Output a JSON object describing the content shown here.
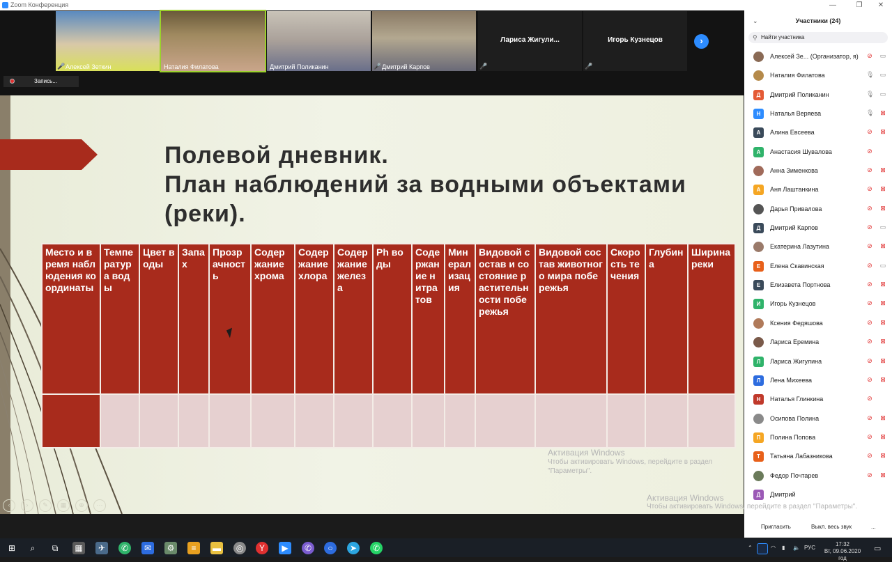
{
  "window": {
    "title": "Zoom Конференция",
    "minimize": "—",
    "restore": "❐",
    "close": "✕"
  },
  "videos": [
    {
      "name": "Алексей Зеткин",
      "muted": true
    },
    {
      "name": "Наталия Филатова",
      "muted": false,
      "active": true
    },
    {
      "name": "Дмитрий Поликанин",
      "muted": false
    },
    {
      "name": "Дмитрий Карпов",
      "muted": true
    },
    {
      "name": "Лариса  Жигули...",
      "muted": true,
      "video": false
    },
    {
      "name": "Игорь Кузнецов",
      "muted": true,
      "video": false
    }
  ],
  "recording": {
    "label": "Запись..."
  },
  "slide": {
    "title": "Полевой дневник.\nПлан наблюдений за водными объектами\n(реки).",
    "columns": [
      "Место и время наблюдения координаты",
      "Температура воды",
      "Цвет воды",
      "Запах",
      "Прозрачность",
      "Содержание хрома",
      "Содержание хлора",
      "Содержание железа",
      "Ph воды",
      "Содержание нитратов",
      "Минерализация",
      "Видовой состав и состояние растительности побережья",
      "Видовой состав животного мира побережья",
      "Скорость течения",
      "Глубина",
      "Ширина реки"
    ]
  },
  "activation": {
    "title": "Активация Windows",
    "body": "Чтобы активировать Windows, перейдите в раздел \"Параметры\".",
    "panel_body": "Чтобы активировать Windows, перейдите в раздел \"Параметры\"."
  },
  "participants_panel": {
    "title": "Участники (24)",
    "search_placeholder": "Найти участника",
    "participants": [
      {
        "name": "Алексей Зе... (Организатор, я)",
        "avatar": "photo",
        "color": "#8a6a55",
        "mic": "muted",
        "cam": "on"
      },
      {
        "name": "Наталия Филатова",
        "avatar": "photo",
        "color": "#b58a4a",
        "mic": "on",
        "cam": "on"
      },
      {
        "name": "Дмитрий Поликанин",
        "avatar": "Д",
        "color": "#e45a35",
        "mic": "on",
        "cam": "on"
      },
      {
        "name": "Наталья Веряева",
        "avatar": "Н",
        "color": "#2d8cff",
        "mic": "on",
        "cam": "off"
      },
      {
        "name": "Алина Евсеева",
        "avatar": "А",
        "color": "#3a4a5a",
        "mic": "muted",
        "cam": "off"
      },
      {
        "name": "Анастасия Шувалова",
        "avatar": "А",
        "color": "#2fb36a",
        "mic": "muted",
        "cam": "none"
      },
      {
        "name": "Анна Зименкова",
        "avatar": "photo",
        "color": "#a06a5a",
        "mic": "muted",
        "cam": "off"
      },
      {
        "name": "Аня Лаштанкина",
        "avatar": "А",
        "color": "#f5a623",
        "mic": "muted",
        "cam": "off"
      },
      {
        "name": "Дарья Привалова",
        "avatar": "photo",
        "color": "#555555",
        "mic": "muted",
        "cam": "off"
      },
      {
        "name": "Дмитрий Карпов",
        "avatar": "Д",
        "color": "#3a4a5a",
        "mic": "muted",
        "cam": "on"
      },
      {
        "name": "Екатерина Лазутина",
        "avatar": "photo",
        "color": "#9a7a6a",
        "mic": "muted",
        "cam": "off"
      },
      {
        "name": "Елена Скавинская",
        "avatar": "Е",
        "color": "#e8601a",
        "mic": "muted",
        "cam": "on"
      },
      {
        "name": "Елизавета Портнова",
        "avatar": "Е",
        "color": "#3a4a5a",
        "mic": "muted",
        "cam": "off"
      },
      {
        "name": "Игорь Кузнецов",
        "avatar": "И",
        "color": "#2fb36a",
        "mic": "muted",
        "cam": "off"
      },
      {
        "name": "Ксения Федяшова",
        "avatar": "photo",
        "color": "#b07a5a",
        "mic": "muted",
        "cam": "off"
      },
      {
        "name": "Лариса Еремина",
        "avatar": "photo",
        "color": "#7a5a4a",
        "mic": "muted",
        "cam": "off"
      },
      {
        "name": "Лариса Жигулина",
        "avatar": "Л",
        "color": "#2fb36a",
        "mic": "muted",
        "cam": "off"
      },
      {
        "name": "Лена Михеева",
        "avatar": "Л",
        "color": "#2d6cdf",
        "mic": "muted",
        "cam": "off"
      },
      {
        "name": "Наталья Глинкина",
        "avatar": "Н",
        "color": "#c0392b",
        "mic": "muted",
        "cam": "none"
      },
      {
        "name": "Осипова Полина",
        "avatar": "photo",
        "color": "#8a8a8a",
        "mic": "muted",
        "cam": "off"
      },
      {
        "name": "Полина Попова",
        "avatar": "П",
        "color": "#f5a623",
        "mic": "muted",
        "cam": "off"
      },
      {
        "name": "Татьяна Лабазникова",
        "avatar": "Т",
        "color": "#e8601a",
        "mic": "muted",
        "cam": "off"
      },
      {
        "name": "Федор Почтарев",
        "avatar": "photo",
        "color": "#6a7a5a",
        "mic": "muted",
        "cam": "off"
      },
      {
        "name": "Дмитрий",
        "avatar": "Д",
        "color": "#9b59b6",
        "mic": "none",
        "cam": "none"
      }
    ],
    "invite_label": "Пригласить",
    "mute_all_label": "Выкл. весь звук",
    "more_label": "..."
  },
  "taskbar": {
    "lang": "РУС",
    "time": "17:32",
    "date": "Вт, 09.06.2020 год"
  }
}
